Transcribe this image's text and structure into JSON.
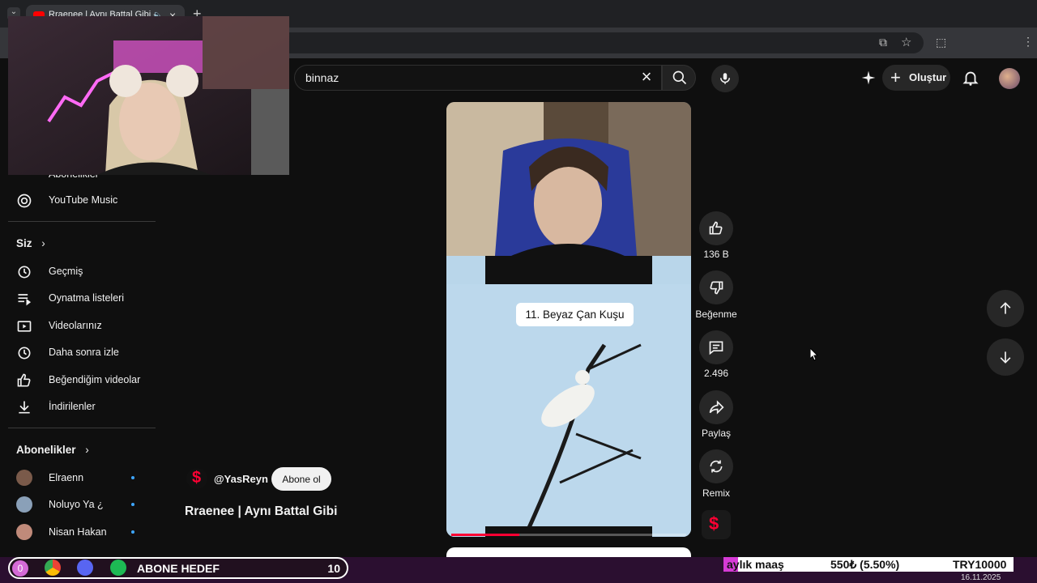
{
  "browser": {
    "tab_title": "Rraenee | Aynı Battal Gibi -",
    "tab_close": "×",
    "new_tab": "+"
  },
  "header": {
    "search_value": "binnaz",
    "create_label": "Oluştur"
  },
  "sidebar": {
    "partial_item": "Abonelikler",
    "music_label": "YouTube Music",
    "you_heading": "Siz",
    "you_items": [
      {
        "icon": "history-icon",
        "label": "Geçmiş"
      },
      {
        "icon": "playlists-icon",
        "label": "Oynatma listeleri"
      },
      {
        "icon": "your-videos-icon",
        "label": "Videolarınız"
      },
      {
        "icon": "watch-later-icon",
        "label": "Daha sonra izle"
      },
      {
        "icon": "liked-videos-icon",
        "label": "Beğendiğim videolar"
      },
      {
        "icon": "download-icon",
        "label": "İndirilenler"
      }
    ],
    "subs_heading": "Abonelikler",
    "subs": [
      {
        "name": "Elraenn",
        "color": "#7a5a4a"
      },
      {
        "name": "Noluyo Ya ¿",
        "color": "#8aa0b8"
      },
      {
        "name": "Nisan Hakan",
        "color": "#c08a7a"
      }
    ]
  },
  "short": {
    "overlay_text": "11. Beyaz Çan Kuşu",
    "channel_handle": "@YasReyn",
    "subscribe_label": "Abone ol",
    "title": "Rraenee | Aynı Battal Gibi",
    "progress_fraction": 0.29
  },
  "actions": {
    "like_count": "136 B",
    "dislike_label": "Beğenme",
    "comment_count": "2.496",
    "share_label": "Paylaş",
    "remix_label": "Remix"
  },
  "overlay": {
    "goal_count": "0",
    "goal_label": "ABONE HEDEF",
    "goal_target": "10",
    "ticker_left": "aylık maaş",
    "ticker_mid": "550₺ (5.50%)",
    "ticker_right": "TRY10000",
    "date": "16.11.2025"
  },
  "colors": {
    "brand_red": "#ff0000",
    "shorts_red": "#ff0033",
    "taskbar_purple": "#2b0f30",
    "goal_pink": "#d46ad6"
  }
}
